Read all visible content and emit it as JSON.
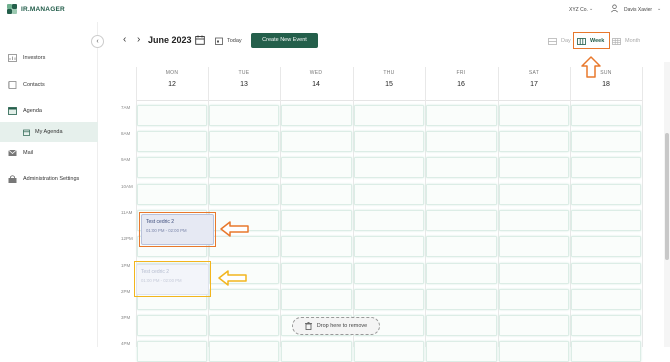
{
  "app": {
    "name": "IR.MANAGER",
    "colors": {
      "brand": "#245f4b",
      "highlight_orange": "#e8782c",
      "highlight_yellow": "#f2b51e"
    }
  },
  "header": {
    "company": "XYZ Co.",
    "user_name": "Davis Xavier",
    "user_icon": "user-icon",
    "caret_icon": "chevron-down-icon"
  },
  "sidebar": {
    "collapse_icon": "chevron-left-icon",
    "items": [
      {
        "label": "Investors",
        "icon": "investors-icon"
      },
      {
        "label": "Contacts",
        "icon": "contacts-icon"
      },
      {
        "label": "Agenda",
        "icon": "agenda-icon"
      },
      {
        "label": "My Agenda",
        "icon": "calendar-icon"
      },
      {
        "label": "Mail",
        "icon": "mail-icon"
      },
      {
        "label": "Administration Settings",
        "icon": "lock-icon"
      }
    ]
  },
  "calendar": {
    "prev_icon": "chevron-left-icon",
    "next_icon": "chevron-right-icon",
    "month_label": "June 2023",
    "today_label": "Today",
    "create_label": "Create New Event",
    "views": {
      "day": "Day",
      "week": "Week",
      "month": "Month",
      "active": "Week"
    },
    "days": [
      {
        "name": "MON",
        "num": "12"
      },
      {
        "name": "TUE",
        "num": "13"
      },
      {
        "name": "WED",
        "num": "14"
      },
      {
        "name": "THU",
        "num": "15"
      },
      {
        "name": "FRI",
        "num": "16"
      },
      {
        "name": "SAT",
        "num": "17"
      },
      {
        "name": "SUN",
        "num": "18"
      }
    ],
    "hours": [
      "7AM",
      "8AM",
      "9AM",
      "10AM",
      "11AM",
      "12PM",
      "1PM",
      "2PM",
      "3PM",
      "4PM"
    ],
    "events": [
      {
        "title": "Test cedric 2",
        "time": "01:00 PM - 02:00 PM",
        "state": "original"
      },
      {
        "title": "Test cedric 2",
        "time": "01:00 PM - 02:00 PM",
        "state": "dragging"
      }
    ],
    "drop_zone_label": "Drop here to remove"
  }
}
